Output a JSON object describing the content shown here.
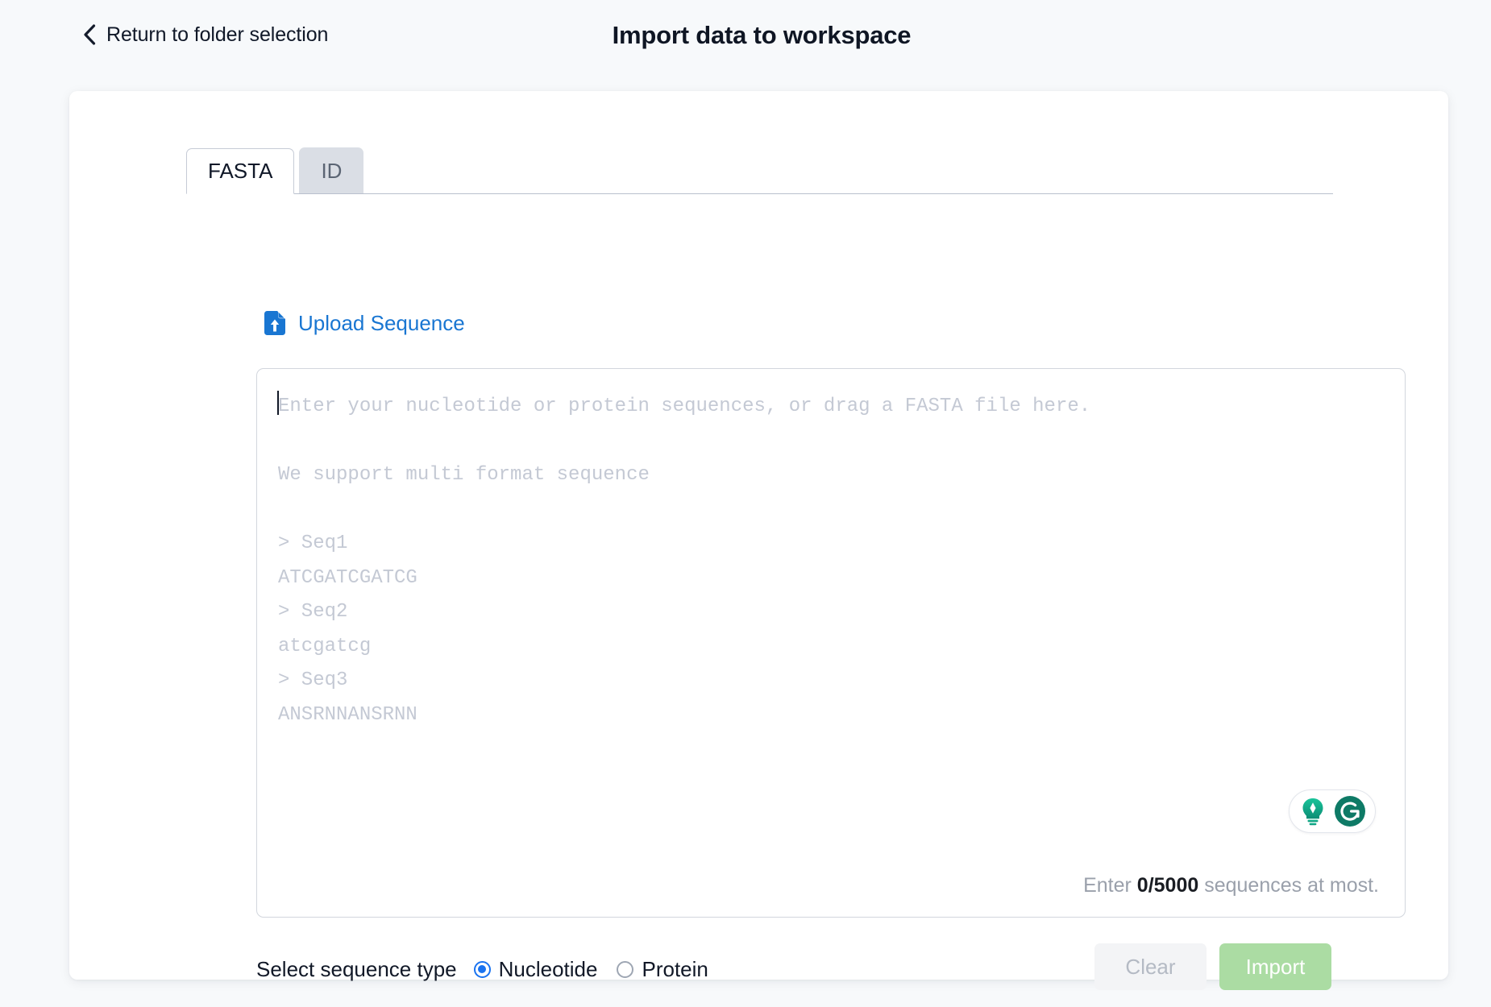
{
  "header": {
    "back_label": "Return to folder selection",
    "back_icon": "chevron-left-icon",
    "title": "Import data to workspace"
  },
  "tabs": [
    {
      "label": "FASTA",
      "active": true
    },
    {
      "label": "ID",
      "active": false
    }
  ],
  "upload": {
    "label": "Upload Sequence",
    "icon": "file-upload-icon",
    "color": "#1976d2"
  },
  "sequence_input": {
    "value": "",
    "placeholder_lines": [
      "Enter your nucleotide or protein sequences, or drag a FASTA file here.",
      "",
      "We support multi format sequence",
      "",
      "> Seq1",
      "ATCGATCGATCG",
      "> Seq2",
      "atcgatcg",
      "> Seq3",
      "ANSRNNANSRNN"
    ],
    "placeholder": "Enter your nucleotide or protein sequences, or drag a FASTA file here.\n\nWe support multi format sequence\n\n> Seq1\nATCGATCGATCG\n> Seq2\natcgatcg\n> Seq3\nANSRNNANSRNN",
    "counter_prefix": "Enter ",
    "counter_value": "0/5000",
    "counter_suffix": " sequences at most.",
    "current_count": 0,
    "max_count": 5000
  },
  "grammarly": {
    "bulb_icon": "lightbulb-icon",
    "logo_icon": "grammarly-g-icon",
    "accent": "#15a07f",
    "logo_color": "#0e7a66"
  },
  "sequence_type": {
    "label": "Select sequence type",
    "options": [
      {
        "label": "Nucleotide",
        "selected": true
      },
      {
        "label": "Protein",
        "selected": false
      }
    ],
    "accent": "#1a73f0"
  },
  "actions": {
    "clear_label": "Clear",
    "import_label": "Import",
    "clear_disabled": true,
    "import_disabled": true,
    "import_color": "#abdca3"
  }
}
